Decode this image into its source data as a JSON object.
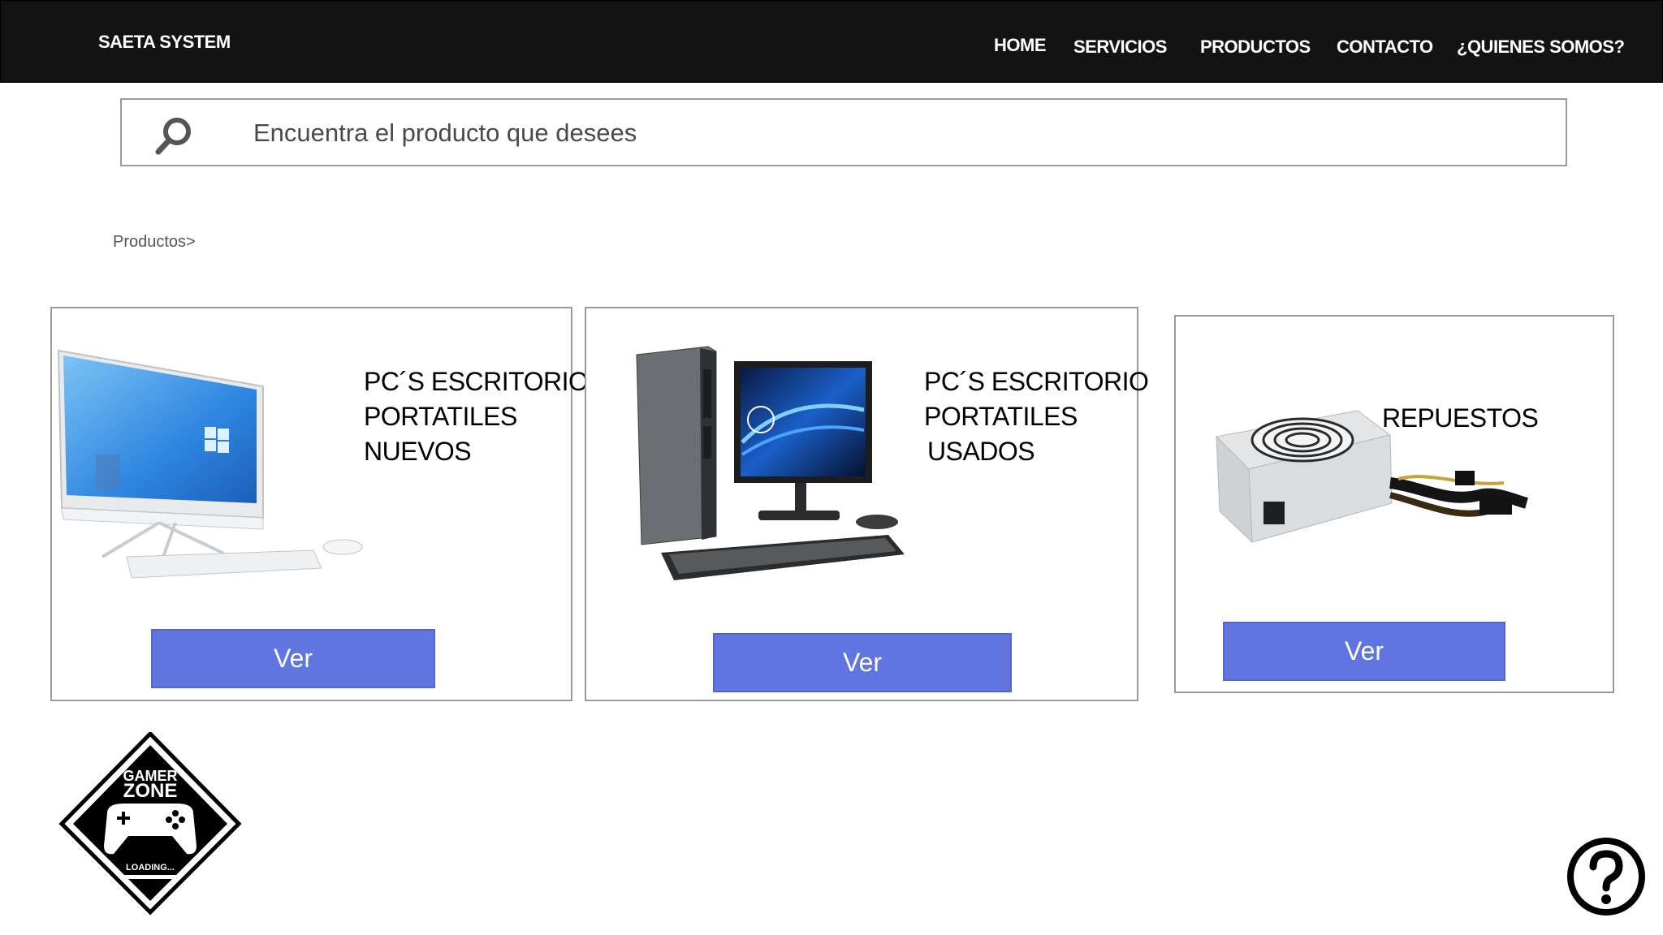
{
  "header": {
    "brand": "SAETA SYSTEM",
    "nav": [
      "HOME",
      "SERVICIOS",
      "PRODUCTOS",
      "CONTACTO",
      "¿QUIENES SOMOS?"
    ]
  },
  "search": {
    "placeholder": "Encuentra el producto que desees"
  },
  "breadcrumb": "Productos>",
  "cards": [
    {
      "lines": [
        "PC´S  ESCRITORIO",
        "PORTATILES",
        "NUEVOS"
      ],
      "button": "Ver",
      "image": "all-in-one-pc"
    },
    {
      "lines": [
        "PC´S  ESCRITORIO",
        "PORTATILES",
        "USADOS"
      ],
      "button": "Ver",
      "image": "desktop-tower-pc"
    },
    {
      "lines": [
        "REPUESTOS"
      ],
      "button": "Ver",
      "image": "power-supply"
    }
  ],
  "logo": {
    "line1": "GAMER",
    "line2": "ZONE",
    "line3": "LOADING..."
  },
  "icons": {
    "search": "search-icon",
    "help": "help-icon"
  },
  "colors": {
    "header": "#131313",
    "button": "#6175e0"
  }
}
